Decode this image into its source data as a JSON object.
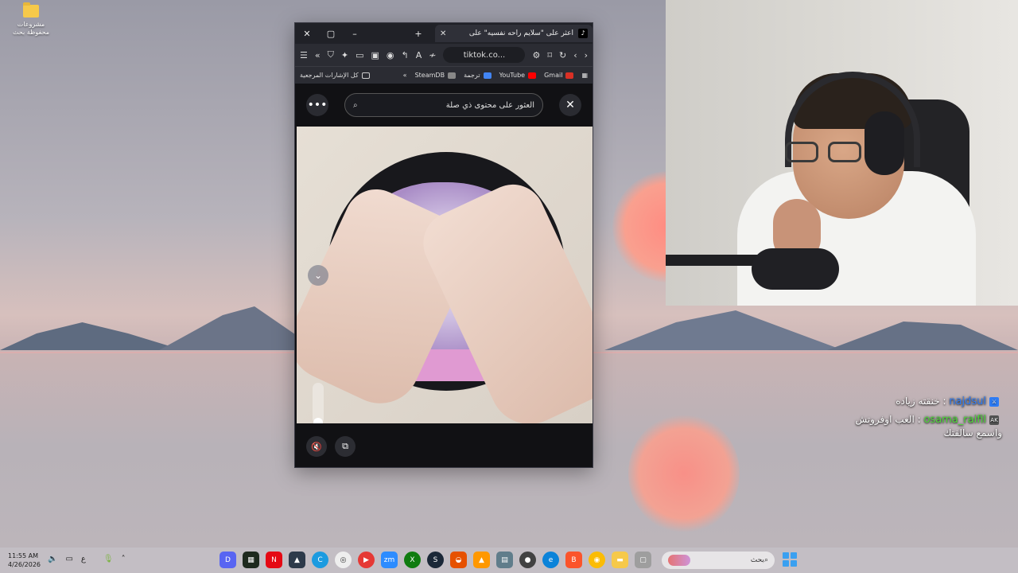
{
  "desktop": {
    "folder_label": "مشروعات محفوظة بحث"
  },
  "browser": {
    "tab_title": "اعثر على \"سلايم راحه نفسيه\" على",
    "url": "tiktok.co...",
    "bookmarks": [
      {
        "label": "Gmail",
        "color": "#d93025"
      },
      {
        "label": "YouTube",
        "color": "#ff0000"
      },
      {
        "label": "ترجمة",
        "color": "#4285f4"
      },
      {
        "label": "SteamDB",
        "color": "#555555"
      }
    ],
    "all_bookmarks_label": "كل الإشارات المرجعية",
    "search_text": "العثور على محتوى ذي صلة"
  },
  "chat": {
    "messages": [
      {
        "user": "najdsul",
        "text": "خنقته زياده",
        "badge": "mod"
      },
      {
        "user": "osama_raifil",
        "text": "العب اوفروتش",
        "badge": "AK"
      }
    ],
    "continuation": "واسمع سالفتك"
  },
  "taskbar": {
    "time": "11:55 AM",
    "date": "4/26/2026",
    "lang": "ع",
    "search_placeholder": "بحث"
  }
}
